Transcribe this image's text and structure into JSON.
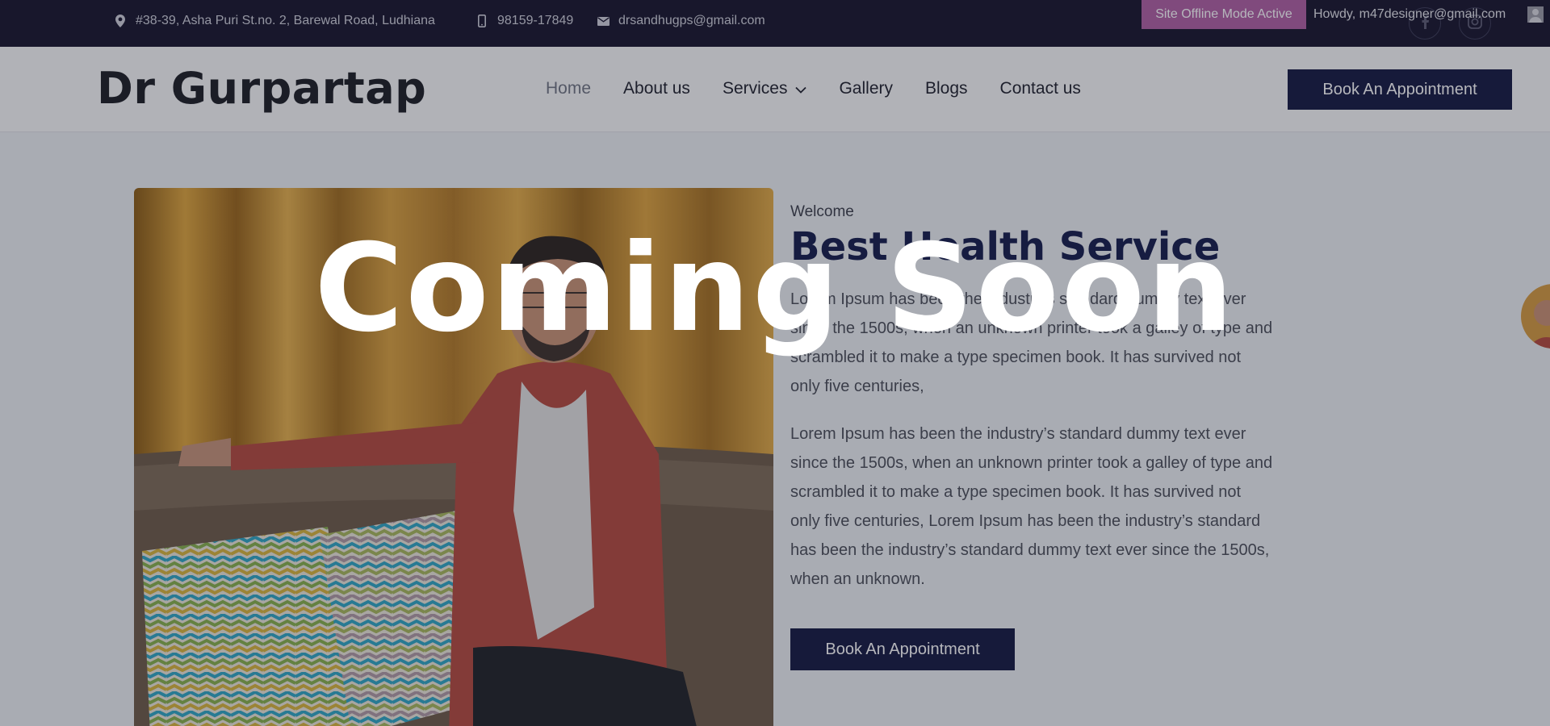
{
  "topbar": {
    "address": "#38-39, Asha Puri St.no. 2, Barewal Road, Ludhiana",
    "phone": "98159-17849",
    "email": "drsandhugps@gmail.com",
    "admin_notice": "Site Offline Mode Active",
    "admin_greeting": "Howdy, m47designer@gmail.com",
    "social": [
      "facebook-icon",
      "instagram-icon"
    ]
  },
  "header": {
    "logo": "Dr Gurpartap",
    "nav": [
      "Home",
      "About us",
      "Services",
      "Gallery",
      "Blogs",
      "Contact us"
    ],
    "cta": "Book An Appointment"
  },
  "main": {
    "eyebrow": "Welcome",
    "title": "Best Health Service",
    "para1": "Lorem Ipsum has been the industry’s standard dummy text ever since the 1500s, when an unknown printer took a galley of type and scrambled it to make a type specimen book. It has survived not only five centuries,",
    "para2": "Lorem Ipsum has been the industry’s standard dummy text ever since the 1500s, when an unknown printer took a galley of type and scrambled it to make a type specimen book. It has survived not only five centuries, Lorem Ipsum has been the industry’s standard  has been the industry’s standard dummy text ever since the 1500s, when an unknown.",
    "cta": "Book An Appointment"
  },
  "overlay": {
    "text": "Coming Soon"
  },
  "colors": {
    "navy": "#13173f",
    "topbar": "#15132b",
    "admin_pill": "#b05fa3"
  }
}
